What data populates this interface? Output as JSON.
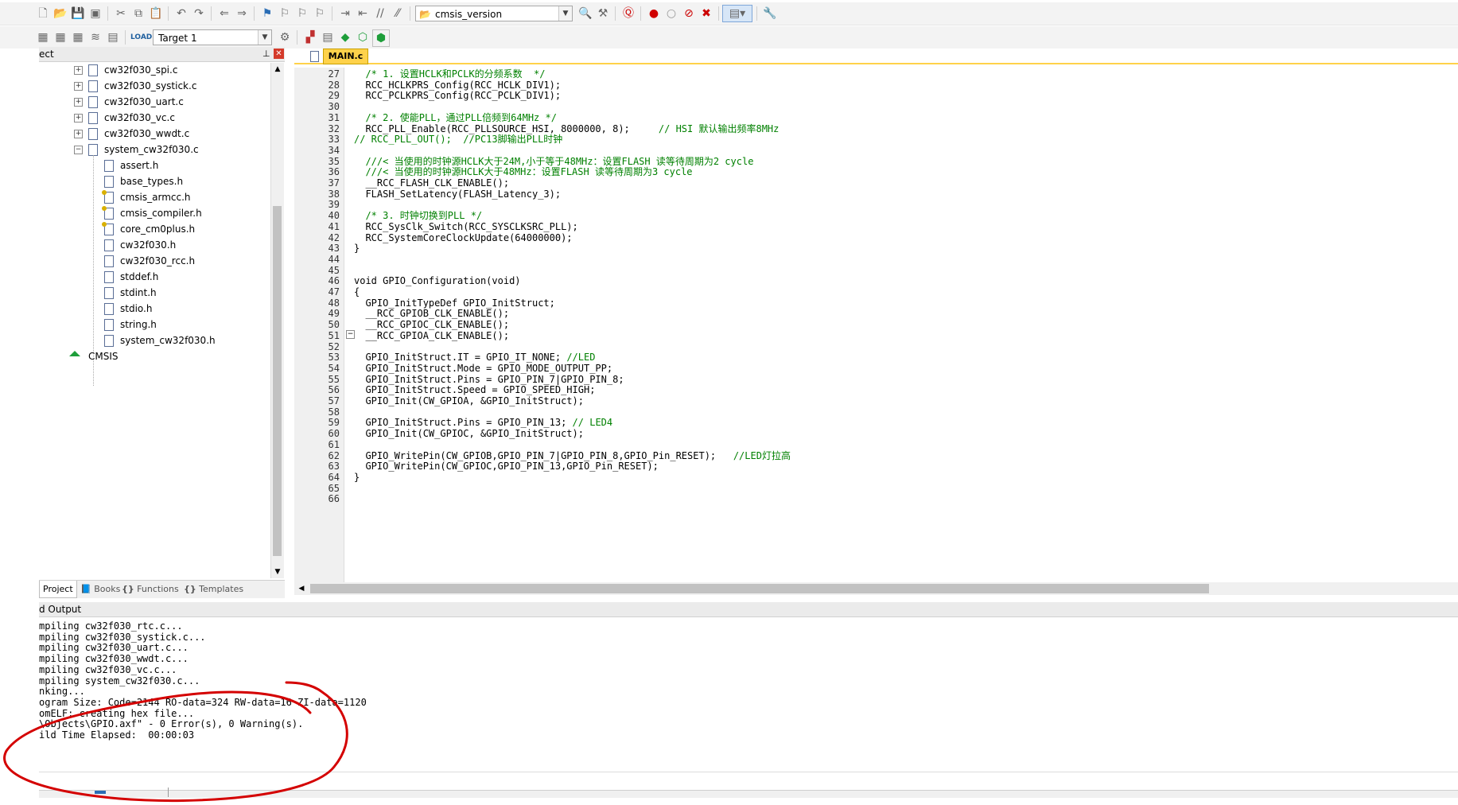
{
  "toolbar": {
    "find_combo_value": "cmsis_version",
    "target_combo_value": "Target 1"
  },
  "project_panel": {
    "title": "ect",
    "tree": [
      {
        "label": "cw32f030_spi.c",
        "expander": "+"
      },
      {
        "label": "cw32f030_systick.c",
        "expander": "+"
      },
      {
        "label": "cw32f030_uart.c",
        "expander": "+"
      },
      {
        "label": "cw32f030_vc.c",
        "expander": "+"
      },
      {
        "label": "cw32f030_wwdt.c",
        "expander": "+"
      },
      {
        "label": "system_cw32f030.c",
        "expander": "−"
      },
      {
        "label": "assert.h"
      },
      {
        "label": "base_types.h"
      },
      {
        "label": "cmsis_armcc.h",
        "icon": "key-file-icon"
      },
      {
        "label": "cmsis_compiler.h",
        "icon": "key-file-icon"
      },
      {
        "label": "core_cm0plus.h",
        "icon": "key-file-icon"
      },
      {
        "label": "cw32f030.h"
      },
      {
        "label": "cw32f030_rcc.h"
      },
      {
        "label": "stddef.h"
      },
      {
        "label": "stdint.h"
      },
      {
        "label": "stdio.h"
      },
      {
        "label": "string.h"
      },
      {
        "label": "system_cw32f030.h"
      },
      {
        "label": "CMSIS",
        "icon": "component-gem-icon"
      }
    ],
    "bottom_tabs": [
      "Project",
      "Books",
      "Functions",
      "Templates"
    ],
    "bottom_tab_icons": [
      "",
      "book-icon",
      "braces-icon",
      "template-icon"
    ]
  },
  "editor": {
    "active_tab": "MAIN.c",
    "lines": [
      {
        "n": "27",
        "t": "  /* 1. 设置HCLK和PCLK的分频系数  */"
      },
      {
        "n": "28",
        "t": "  RCC_HCLKPRS_Config(RCC_HCLK_DIV1);"
      },
      {
        "n": "29",
        "t": "  RCC_PCLKPRS_Config(RCC_PCLK_DIV1);"
      },
      {
        "n": "30",
        "t": ""
      },
      {
        "n": "31",
        "t": "  /* 2. 使能PLL，通过PLL倍频到64MHz */"
      },
      {
        "n": "32",
        "t": "  RCC_PLL_Enable(RCC_PLLSOURCE_HSI, 8000000, 8);     // HSI 默认输出频率8MHz"
      },
      {
        "n": "33",
        "t": "// RCC_PLL_OUT();  //PC13脚输出PLL时钟"
      },
      {
        "n": "34",
        "t": ""
      },
      {
        "n": "35",
        "t": "  ///< 当使用的时钟源HCLK大于24M,小于等于48MHz：设置FLASH 读等待周期为2 cycle"
      },
      {
        "n": "36",
        "t": "  ///< 当使用的时钟源HCLK大于48MHz：设置FLASH 读等待周期为3 cycle"
      },
      {
        "n": "37",
        "t": "  __RCC_FLASH_CLK_ENABLE();"
      },
      {
        "n": "38",
        "t": "  FLASH_SetLatency(FLASH_Latency_3);"
      },
      {
        "n": "39",
        "t": ""
      },
      {
        "n": "40",
        "t": "  /* 3. 时钟切换到PLL */"
      },
      {
        "n": "41",
        "t": "  RCC_SysClk_Switch(RCC_SYSCLKSRC_PLL);"
      },
      {
        "n": "42",
        "t": "  RCC_SystemCoreClockUpdate(64000000);"
      },
      {
        "n": "43",
        "t": "}"
      },
      {
        "n": "44",
        "t": ""
      },
      {
        "n": "45",
        "t": ""
      },
      {
        "n": "46",
        "t": "void GPIO_Configuration(void)"
      },
      {
        "n": "47",
        "t": "{"
      },
      {
        "n": "48",
        "t": "  GPIO_InitTypeDef GPIO_InitStruct;"
      },
      {
        "n": "49",
        "t": "  __RCC_GPIOB_CLK_ENABLE();"
      },
      {
        "n": "50",
        "t": "  __RCC_GPIOC_CLK_ENABLE();"
      },
      {
        "n": "51",
        "t": "  __RCC_GPIOA_CLK_ENABLE();"
      },
      {
        "n": "52",
        "t": ""
      },
      {
        "n": "53",
        "t": "  GPIO_InitStruct.IT = GPIO_IT_NONE; //LED"
      },
      {
        "n": "54",
        "t": "  GPIO_InitStruct.Mode = GPIO_MODE_OUTPUT_PP;"
      },
      {
        "n": "55",
        "t": "  GPIO_InitStruct.Pins = GPIO_PIN_7|GPIO_PIN_8;"
      },
      {
        "n": "56",
        "t": "  GPIO_InitStruct.Speed = GPIO_SPEED_HIGH;"
      },
      {
        "n": "57",
        "t": "  GPIO_Init(CW_GPIOA, &GPIO_InitStruct);"
      },
      {
        "n": "58",
        "t": ""
      },
      {
        "n": "59",
        "t": "  GPIO_InitStruct.Pins = GPIO_PIN_13; // LED4"
      },
      {
        "n": "60",
        "t": "  GPIO_Init(CW_GPIOC, &GPIO_InitStruct);"
      },
      {
        "n": "61",
        "t": ""
      },
      {
        "n": "62",
        "t": "  GPIO_WritePin(CW_GPIOB,GPIO_PIN_7|GPIO_PIN_8,GPIO_Pin_RESET);   //LED灯拉高"
      },
      {
        "n": "63",
        "t": "  GPIO_WritePin(CW_GPIOC,GPIO_PIN_13,GPIO_Pin_RESET);"
      },
      {
        "n": "64",
        "t": "}"
      },
      {
        "n": "65",
        "t": ""
      },
      {
        "n": "66",
        "t": ""
      }
    ]
  },
  "output": {
    "title": "d Output",
    "lines": [
      "mpiling cw32f030_rtc.c...",
      "mpiling cw32f030_systick.c...",
      "mpiling cw32f030_uart.c...",
      "mpiling cw32f030_wwdt.c...",
      "mpiling cw32f030_vc.c...",
      "mpiling system_cw32f030.c...",
      "nking...",
      "ogram Size: Code=2144 RO-data=324 RW-data=16 ZI-data=1120",
      "omELF: creating hex file...",
      "\\Objects\\GPIO.axf\" - 0 Error(s), 0 Warning(s).",
      "ild Time Elapsed:  00:00:03"
    ]
  },
  "colors": {
    "annotation_circle": "#d40000",
    "tab_active": "#ffd24a",
    "comment": "#008000"
  }
}
